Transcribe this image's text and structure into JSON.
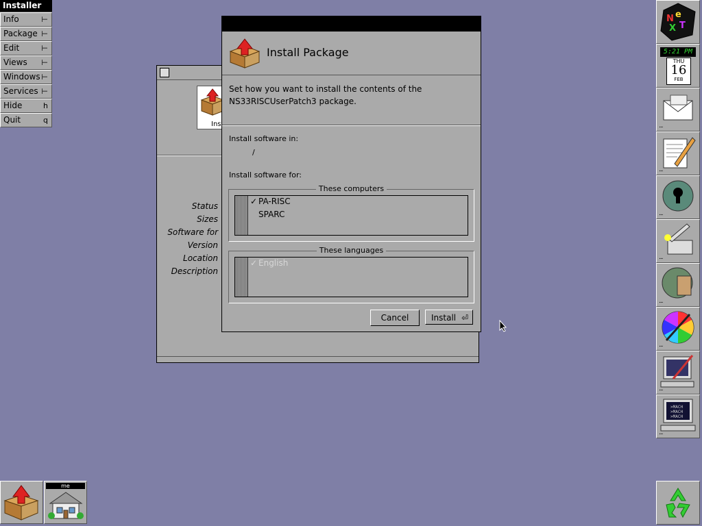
{
  "menu": {
    "title": "Installer",
    "items": [
      {
        "label": "Info",
        "key": "⊢"
      },
      {
        "label": "Package",
        "key": "⊢"
      },
      {
        "label": "Edit",
        "key": "⊢"
      },
      {
        "label": "Views",
        "key": "⊢"
      },
      {
        "label": "Windows",
        "key": "⊢"
      },
      {
        "label": "Services",
        "key": "⊢"
      },
      {
        "label": "Hide",
        "key": "h"
      },
      {
        "label": "Quit",
        "key": "q"
      }
    ]
  },
  "background_window": {
    "icon_label": "Inst",
    "labels": [
      "Status",
      "Sizes",
      "Software for",
      "Version",
      "Location",
      "Description"
    ]
  },
  "dialog": {
    "title": "Install Package",
    "description": "Set how you want to install the contents of the NS33RISCUserPatch3 package.",
    "install_in_label": "Install software in:",
    "install_in_value": "/",
    "install_for_label": "Install software for:",
    "computers": {
      "legend": "These computers",
      "items": [
        {
          "label": "PA-RISC",
          "checked": true
        },
        {
          "label": "SPARC",
          "checked": false
        }
      ]
    },
    "languages": {
      "legend": "These languages",
      "items": [
        {
          "label": "English",
          "checked": true,
          "disabled": true
        }
      ]
    },
    "cancel_label": "Cancel",
    "install_label": "Install"
  },
  "dock": {
    "clock_time": "5:21 PM",
    "clock_dow": "THU",
    "clock_day": "16",
    "clock_month": "FEB",
    "icons": [
      "next-logo-icon",
      "clock-icon",
      "mail-icon",
      "edit-icon",
      "keyhole-globe-icon",
      "preferences-icon",
      "globe-book-icon",
      "color-wheel-icon",
      "monitor-tool-icon",
      "mach-terminal-icon",
      "recycler-icon"
    ]
  },
  "shelf": {
    "me_label": "me"
  }
}
